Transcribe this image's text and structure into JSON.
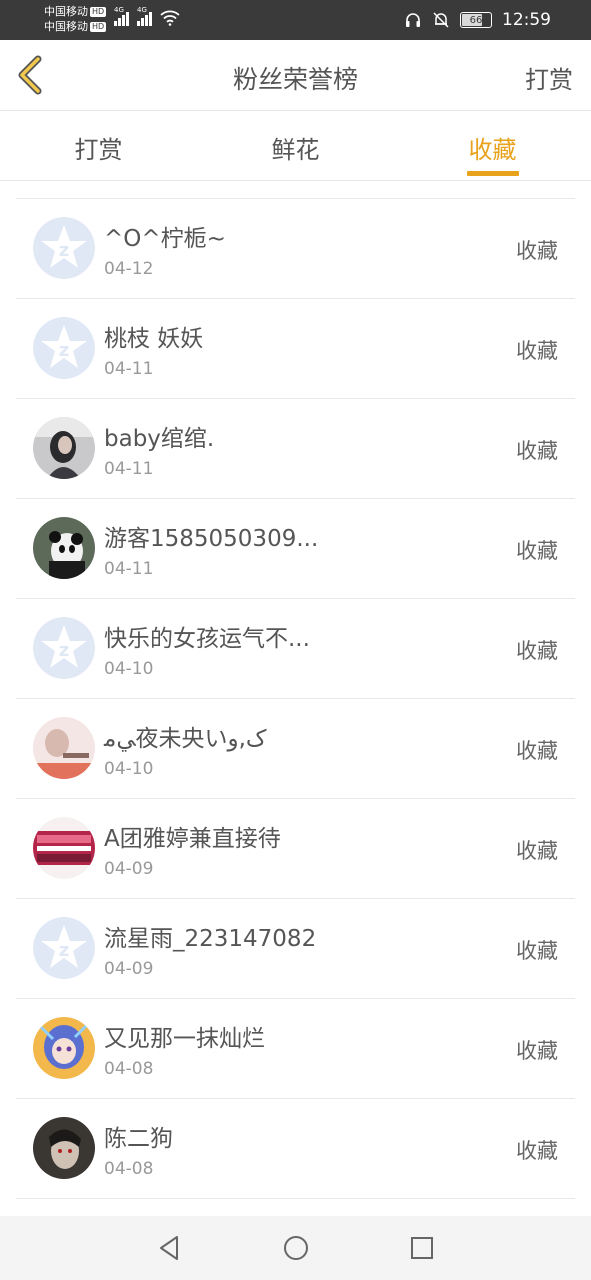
{
  "status_bar": {
    "carrier1": "中国移动",
    "carrier2": "中国移动",
    "hd": "HD",
    "net1": "4G",
    "net2": "4G",
    "battery": "66",
    "time": "12:59"
  },
  "header": {
    "title": "粉丝荣誉榜",
    "action": "打赏",
    "back_icon": "chevron-left-icon",
    "accent": "#e8a21c"
  },
  "tabs": [
    {
      "label": "打赏",
      "active": false
    },
    {
      "label": "鲜花",
      "active": false
    },
    {
      "label": "收藏",
      "active": true
    }
  ],
  "list": [
    {
      "name": "^O^柠栀~",
      "date": "04-12",
      "type": "收藏",
      "avatar": "default-star"
    },
    {
      "name": "桃枝 妖妖",
      "date": "04-11",
      "type": "收藏",
      "avatar": "default-star"
    },
    {
      "name": "baby绾绾.",
      "date": "04-11",
      "type": "收藏",
      "avatar": "photo-girl"
    },
    {
      "name": "游客1585050309...",
      "date": "04-11",
      "type": "收藏",
      "avatar": "photo-panda"
    },
    {
      "name": "快乐的女孩运气不...",
      "date": "04-10",
      "type": "收藏",
      "avatar": "default-star"
    },
    {
      "name": "ﻲﻣ夜未央いک,ﻭ",
      "date": "04-10",
      "type": "收藏",
      "avatar": "photo-pink"
    },
    {
      "name": "A团雅婷兼直接待",
      "date": "04-09",
      "type": "收藏",
      "avatar": "photo-banner"
    },
    {
      "name": "流星雨_223147082",
      "date": "04-09",
      "type": "收藏",
      "avatar": "default-star"
    },
    {
      "name": "又见那一抹灿烂",
      "date": "04-08",
      "type": "收藏",
      "avatar": "photo-anime"
    },
    {
      "name": "陈二狗",
      "date": "04-08",
      "type": "收藏",
      "avatar": "photo-dark"
    }
  ],
  "navbar": [
    "back-triangle-icon",
    "home-circle-icon",
    "recents-square-icon"
  ]
}
